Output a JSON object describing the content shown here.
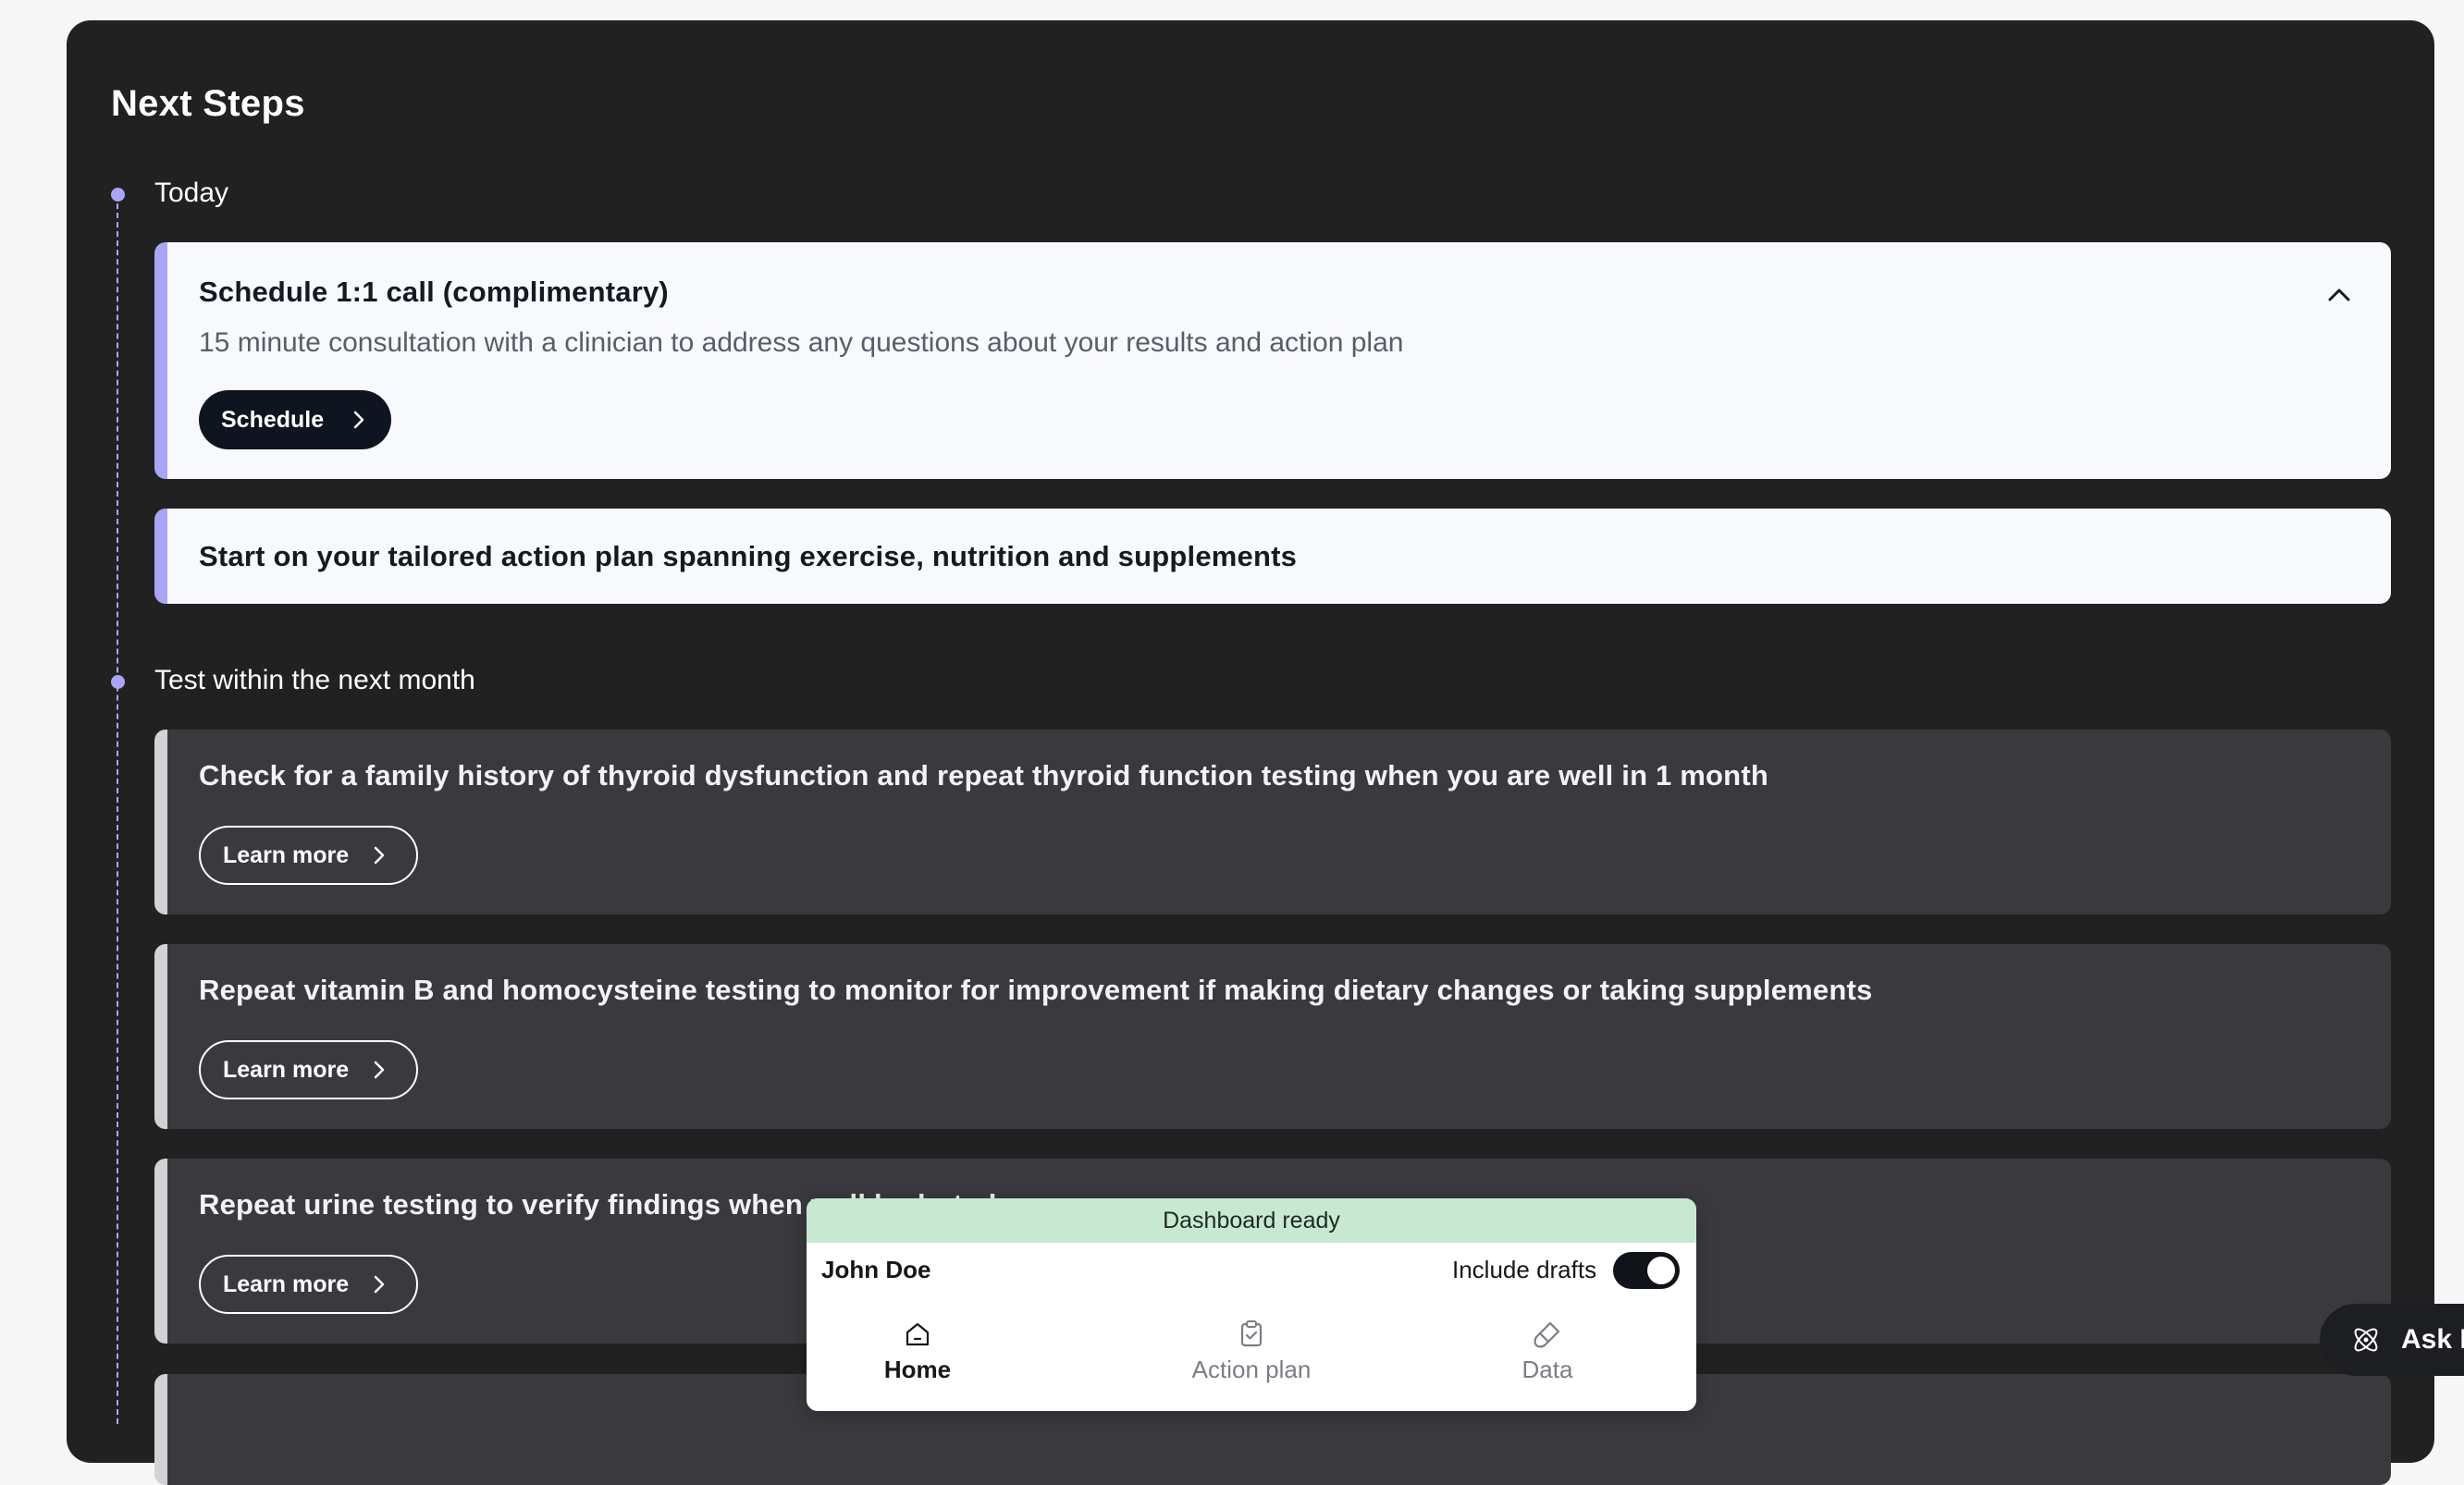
{
  "section_title": "Next Steps",
  "timeline": {
    "today_label": "Today",
    "month_label": "Test within the next month"
  },
  "cards": {
    "schedule_call": {
      "title": "Schedule 1:1 call (complimentary)",
      "description": "15 minute consultation with a clinician to address any questions about your results and action plan",
      "button_label": "Schedule"
    },
    "action_plan": {
      "title": "Start on your tailored action plan spanning exercise, nutrition and supplements"
    },
    "thyroid": {
      "title": "Check for a family history of thyroid dysfunction and repeat thyroid function testing when you are well in 1 month",
      "button_label": "Learn more"
    },
    "vitamin_b": {
      "title": "Repeat vitamin B and homocysteine testing to monitor for improvement if making dietary changes or taking supplements",
      "button_label": "Learn more"
    },
    "urine": {
      "title": "Repeat urine testing to verify findings when well hydrated",
      "button_label": "Learn more"
    }
  },
  "dashboard_popup": {
    "banner": "Dashboard ready",
    "user_name": "John Doe",
    "drafts_label": "Include drafts",
    "drafts_enabled": true,
    "nav": [
      {
        "label": "Home",
        "icon": "home-icon",
        "active": true
      },
      {
        "label": "Action plan",
        "icon": "clipboard-check-icon",
        "active": false
      },
      {
        "label": "Data",
        "icon": "test-tube-icon",
        "active": false
      }
    ]
  },
  "ask_button": {
    "label": "Ask M",
    "icon": "atom-icon"
  },
  "colors": {
    "accent": "#a9a6f5",
    "panel_bg": "#212122",
    "light_card_bg": "#f8f9fc",
    "dark_card_bg": "#3a3a3e",
    "banner_green": "#c9e8d2"
  }
}
